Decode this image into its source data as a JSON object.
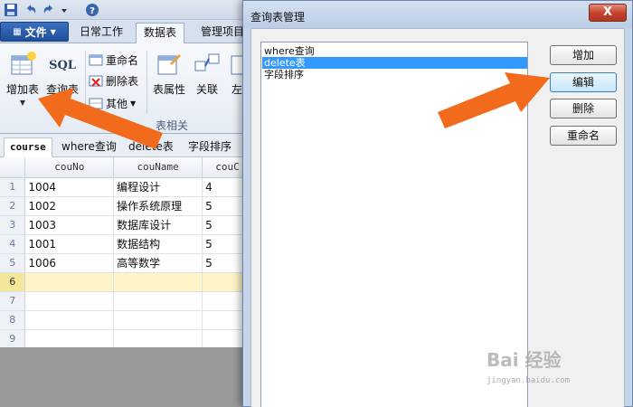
{
  "colors": {
    "accent": "#1f4f9b",
    "selection": "#3399ff",
    "arrow": "#f26a1b",
    "close_button": "#c2412a"
  },
  "toolbar": {
    "file_label": "文件",
    "tabs": [
      "日常工作",
      "数据表",
      "管理项目"
    ],
    "active_tab": "数据表",
    "add_table": "增加表",
    "sql_icon_text": "SQL",
    "query_table": "查询表",
    "rename": "重命名",
    "delete_table": "删除表",
    "other": "其他",
    "table_props": "表属性",
    "relation": "关联",
    "left_partial": "左",
    "group_label": "表相关",
    "icons": [
      "save-icon",
      "undo-icon",
      "redo-icon",
      "dropdown-icon",
      "help-icon",
      "add-table-icon",
      "sql-icon",
      "rename-icon",
      "delete-table-icon",
      "other-icon",
      "table-props-icon",
      "relation-icon"
    ]
  },
  "doc_tabs": [
    "course",
    "where查询",
    "delete表",
    "字段排序"
  ],
  "grid": {
    "columns": [
      "couNo",
      "couName",
      "couC"
    ],
    "rows": [
      {
        "num": "1",
        "cells": [
          "1004",
          "编程设计",
          "4"
        ]
      },
      {
        "num": "2",
        "cells": [
          "1002",
          "操作系统原理",
          "5"
        ]
      },
      {
        "num": "3",
        "cells": [
          "1003",
          "数据库设计",
          "5"
        ]
      },
      {
        "num": "4",
        "cells": [
          "1001",
          "数据结构",
          "5"
        ]
      },
      {
        "num": "5",
        "cells": [
          "1006",
          "高等数学",
          "5"
        ]
      },
      {
        "num": "6",
        "cells": [
          "",
          "",
          ""
        ]
      },
      {
        "num": "7",
        "cells": [
          "",
          "",
          ""
        ]
      },
      {
        "num": "8",
        "cells": [
          "",
          "",
          ""
        ]
      },
      {
        "num": "9",
        "cells": [
          "",
          "",
          ""
        ]
      }
    ],
    "selected_row": "6"
  },
  "dialog": {
    "title": "查询表管理",
    "close_label": "X",
    "list_items": [
      "where查询",
      "delete表",
      "字段排序"
    ],
    "selected_item": "delete表",
    "buttons": [
      "增加",
      "编辑",
      "删除",
      "重命名"
    ],
    "hovered_button": "编辑"
  },
  "watermark": {
    "text": "Bai 经验",
    "sub": "jingyan.baidu.com"
  }
}
